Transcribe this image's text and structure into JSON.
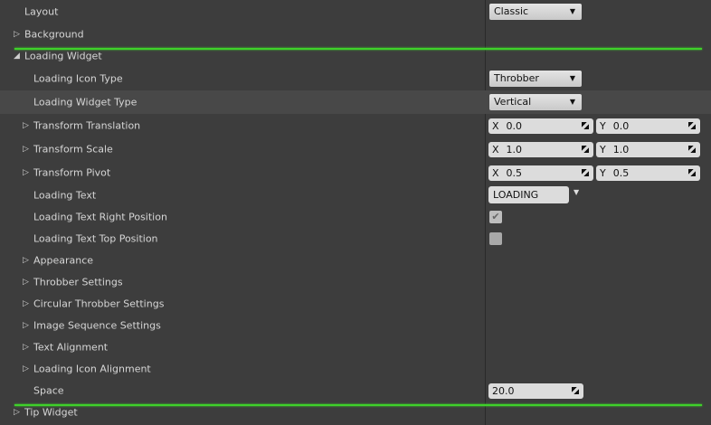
{
  "rows": {
    "layout": {
      "label": "Layout",
      "value": "Classic"
    },
    "background": {
      "label": "Background"
    },
    "loading_widget": {
      "label": "Loading Widget"
    },
    "loading_icon_type": {
      "label": "Loading Icon Type",
      "value": "Throbber"
    },
    "loading_widget_type": {
      "label": "Loading Widget Type",
      "value": "Vertical"
    },
    "transform_translation": {
      "label": "Transform Translation",
      "x": "0.0",
      "y": "0.0"
    },
    "transform_scale": {
      "label": "Transform Scale",
      "x": "1.0",
      "y": "1.0"
    },
    "transform_pivot": {
      "label": "Transform Pivot",
      "x": "0.5",
      "y": "0.5"
    },
    "loading_text": {
      "label": "Loading Text",
      "value": "LOADING"
    },
    "loading_text_right": {
      "label": "Loading Text Right Position",
      "checked": true
    },
    "loading_text_top": {
      "label": "Loading Text Top Position",
      "checked": false
    },
    "appearance": {
      "label": "Appearance"
    },
    "throbber_settings": {
      "label": "Throbber Settings"
    },
    "circular_throbber_settings": {
      "label": "Circular Throbber Settings"
    },
    "image_sequence_settings": {
      "label": "Image Sequence Settings"
    },
    "text_alignment": {
      "label": "Text Alignment"
    },
    "loading_icon_alignment": {
      "label": "Loading Icon Alignment"
    },
    "space": {
      "label": "Space",
      "value": "20.0"
    },
    "tip_widget": {
      "label": "Tip Widget"
    }
  },
  "axis_labels": {
    "x": "X",
    "y": "Y"
  },
  "check_glyph": "✔",
  "colors": {
    "background": "#3d3d3d",
    "highlight": "#484848",
    "accent_line": "#3fd12a"
  }
}
